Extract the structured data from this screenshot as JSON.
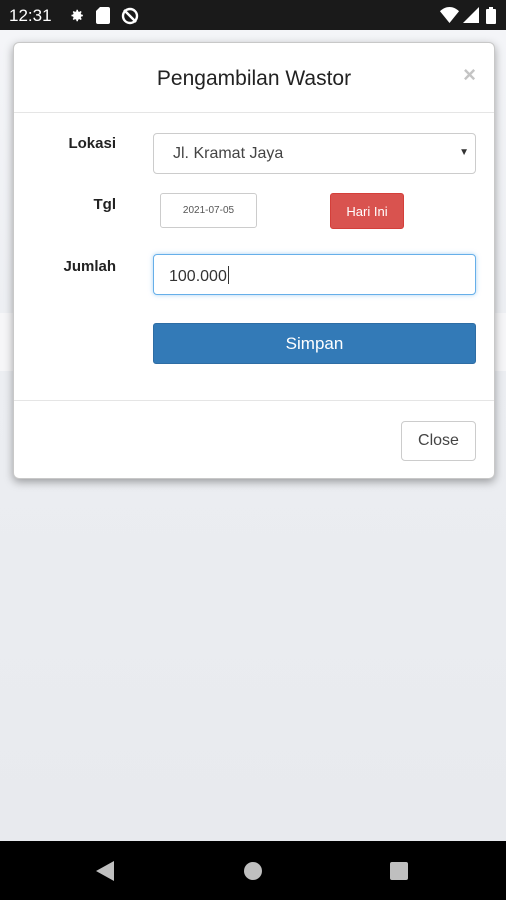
{
  "status_bar": {
    "time": "12:31",
    "icons": [
      "gear-icon",
      "sd-card-icon",
      "sync-off-icon",
      "wifi-icon",
      "signal-icon",
      "battery-icon"
    ]
  },
  "modal": {
    "title": "Pengambilan Wastor",
    "close_glyph": "×",
    "fields": {
      "lokasi_label": "Lokasi",
      "lokasi_value": "Jl. Kramat Jaya",
      "tgl_label": "Tgl",
      "tgl_value": "2021-07-05",
      "hari_ini_label": "Hari Ini",
      "jumlah_label": "Jumlah",
      "jumlah_value": "100.000"
    },
    "save_label": "Simpan",
    "close_label": "Close"
  },
  "colors": {
    "primary": "#337ab7",
    "danger": "#d9534f",
    "focus": "#66afe9"
  }
}
